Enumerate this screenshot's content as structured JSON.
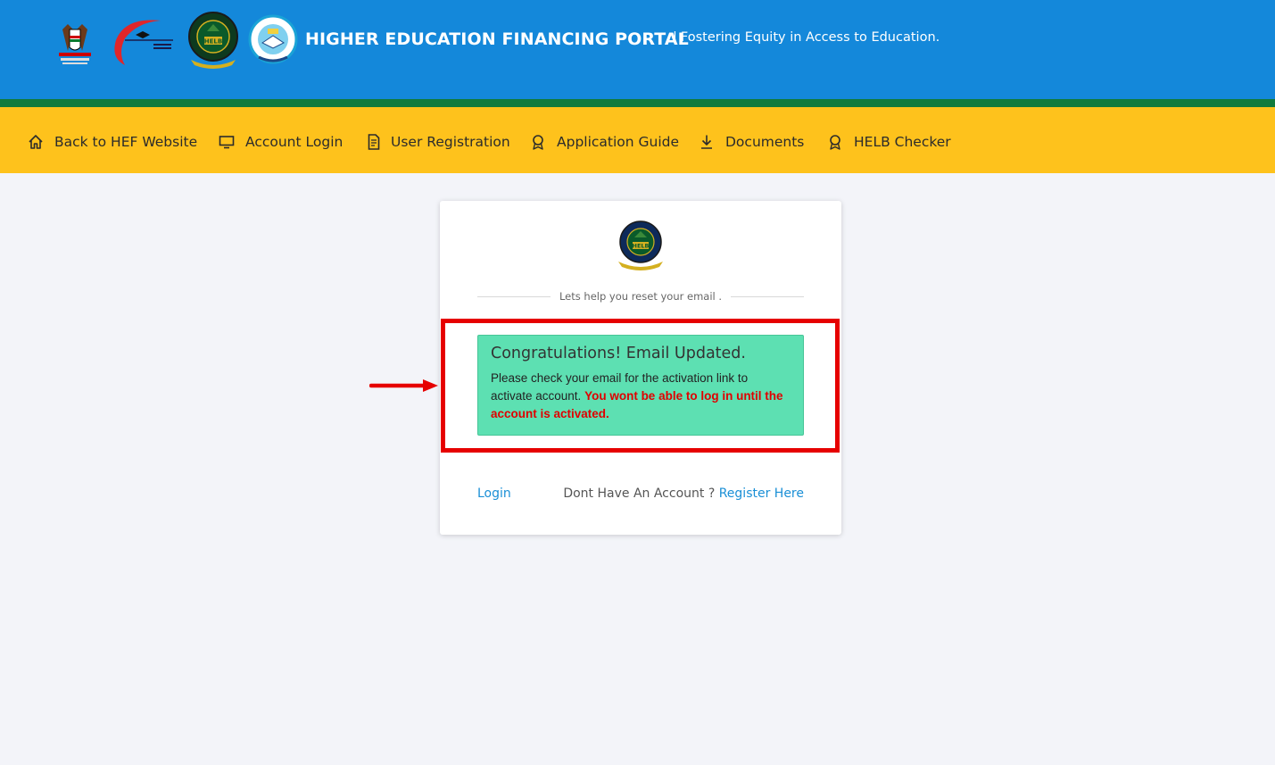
{
  "header": {
    "title": "HIGHER EDUCATION FINANCING PORTAL",
    "separator": "|",
    "tagline": "Fostering Equity in Access to Education.",
    "logos": [
      "kenya-coat-of-arms-logo",
      "ministry-of-education-logo",
      "helb-logo",
      "universities-fund-logo"
    ]
  },
  "nav": {
    "items": [
      {
        "label": "Back to HEF Website",
        "icon": "home-icon"
      },
      {
        "label": "Account Login",
        "icon": "monitor-icon"
      },
      {
        "label": "User Registration",
        "icon": "document-icon"
      },
      {
        "label": "Application Guide",
        "icon": "award-icon"
      },
      {
        "label": "Documents",
        "icon": "download-icon"
      },
      {
        "label": "HELB Checker",
        "icon": "award-icon"
      }
    ]
  },
  "card": {
    "divider_text": "Lets help you reset your email .",
    "alert": {
      "title": "Congratulations! Email Updated.",
      "body": "Please check your email for the activation link to activate account.",
      "warning": "You wont be able to log in until the account is activated."
    },
    "login_label": "Login",
    "register_prompt": "Dont Have An Account ?",
    "register_label": "Register Here"
  },
  "colors": {
    "header_blue": "#1488da",
    "strip_green": "#117a3c",
    "nav_yellow": "#fec21c",
    "alert_green": "#5de0b2",
    "highlight_red": "#e60000",
    "link_blue": "#1a8fd6"
  }
}
